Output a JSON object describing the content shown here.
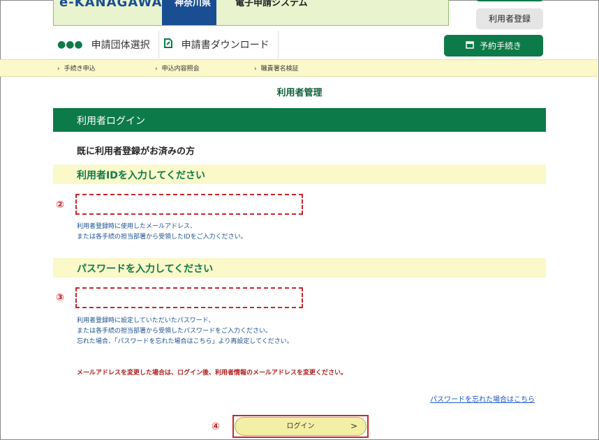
{
  "header": {
    "logo_text": "e-KANAGAWA",
    "prefecture": "神奈川県",
    "system_title": "電子申請システム",
    "register_button": "利用者登録",
    "reserve_button": "予約手続き"
  },
  "nav": {
    "items": [
      {
        "label": "申請団体選択",
        "icon": "group-icon"
      },
      {
        "label": "申請書ダウンロード",
        "icon": "download-doc-icon"
      }
    ]
  },
  "steps": [
    "手続き申込",
    "申込内容照会",
    "職責署名検証"
  ],
  "page_title": "利用者管理",
  "section": {
    "title": "利用者ログイン",
    "subheading": "既に利用者登録がお済みの方"
  },
  "user_id": {
    "label": "利用者IDを入力してください",
    "marker": "②",
    "help_lines": [
      "利用者登録時に使用したメールアドレス、",
      "または各手続の担当部署から受領したIDをご入力ください。"
    ]
  },
  "password": {
    "label": "パスワードを入力してください",
    "marker": "③",
    "help_lines": [
      "利用者登録時に設定していただいたパスワード、",
      "または各手続の担当部署から受領したパスワードをご入力ください。",
      "忘れた場合、「パスワードを忘れた場合はこちら」より再設定してください。"
    ]
  },
  "warning": "メールアドレスを変更した場合は、ログイン後、利用者情報のメールアドレスを変更ください。",
  "forgot_link": "パスワードを忘れた場合はこちら",
  "login": {
    "marker": "④",
    "label": "ログイン",
    "chevron": ">"
  },
  "colors": {
    "brand_green": "#0d7a49",
    "pale_yellow": "#fbf8c9",
    "highlight_red": "#c8262c"
  }
}
